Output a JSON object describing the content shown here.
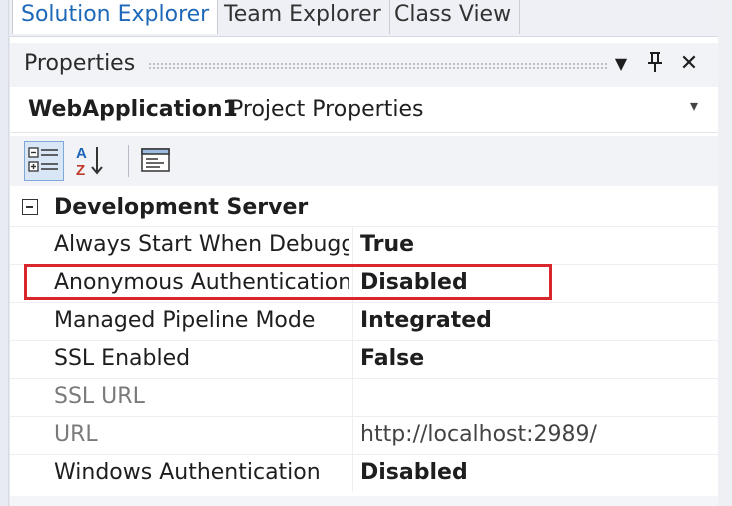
{
  "tabs": [
    {
      "label": "Solution Explorer",
      "active": true
    },
    {
      "label": "Team Explorer",
      "active": false
    },
    {
      "label": "Class View",
      "active": false
    }
  ],
  "panel": {
    "title": "Properties",
    "buttons": {
      "dropdown": "▼",
      "pin": "⊥",
      "close": "✕"
    }
  },
  "selector": {
    "object_name": "WebApplication1",
    "object_type": "Project Properties",
    "arrow": "▾"
  },
  "toolbar": {
    "buttons": [
      {
        "icon": "categorized-icon",
        "pressed": true
      },
      {
        "icon": "alphabetical-icon",
        "pressed": false
      },
      {
        "icon": "property-pages-icon",
        "pressed": false
      }
    ]
  },
  "grid": {
    "category": {
      "label": "Development Server",
      "expanded": true
    },
    "rows": [
      {
        "name": "Always Start When Debugging",
        "name_visible": "Always Start When Debuggi",
        "value": "True",
        "modified": true,
        "readonly": false
      },
      {
        "name": "Anonymous Authentication",
        "value": "Disabled",
        "modified": true,
        "readonly": false,
        "highlighted": true
      },
      {
        "name": "Managed Pipeline Mode",
        "value": "Integrated",
        "modified": true,
        "readonly": false
      },
      {
        "name": "SSL Enabled",
        "value": "False",
        "modified": true,
        "readonly": false
      },
      {
        "name": "SSL URL",
        "value": "",
        "modified": false,
        "readonly": true
      },
      {
        "name": "URL",
        "value": "http://localhost:2989/",
        "modified": false,
        "readonly": true
      },
      {
        "name": "Windows Authentication",
        "value": "Disabled",
        "modified": true,
        "readonly": false
      }
    ]
  },
  "colors": {
    "active_tab_text": "#1e68b8",
    "highlight": "#d9262c",
    "panel_bg": "#f1f3f7"
  }
}
